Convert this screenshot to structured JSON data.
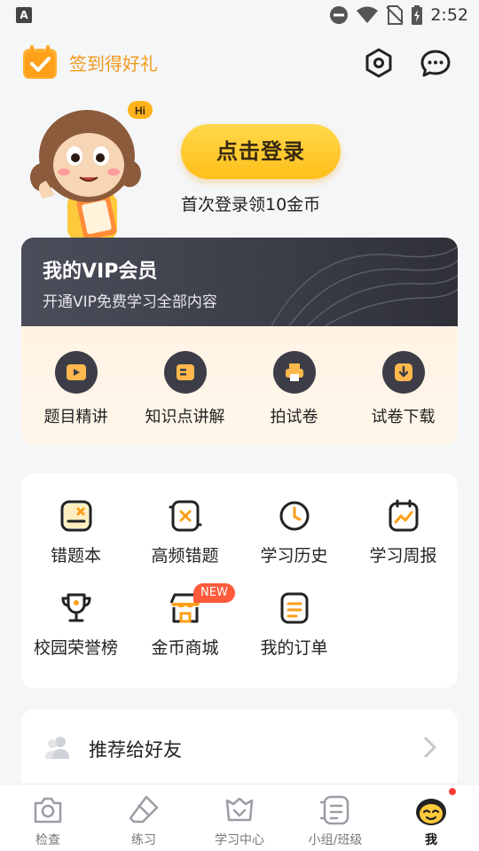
{
  "status_bar": {
    "time": "2:52",
    "notification_letter": "A"
  },
  "header": {
    "checkin_label": "签到得好礼"
  },
  "profile": {
    "mascot_bubble": "Hi",
    "login_button": "点击登录",
    "login_hint": "首次登录领10金币"
  },
  "vip": {
    "title": "我的VIP会员",
    "subtitle": "开通VIP免费学习全部内容",
    "items": [
      {
        "label": "题目精讲",
        "icon": "play-icon"
      },
      {
        "label": "知识点讲解",
        "icon": "book-icon"
      },
      {
        "label": "拍试卷",
        "icon": "printer-icon"
      },
      {
        "label": "试卷下载",
        "icon": "download-icon"
      }
    ]
  },
  "tools": {
    "items": [
      {
        "label": "错题本",
        "icon": "wrong-notebook-icon"
      },
      {
        "label": "高频错题",
        "icon": "frequent-error-icon"
      },
      {
        "label": "学习历史",
        "icon": "clock-icon"
      },
      {
        "label": "学习周报",
        "icon": "weekly-report-icon"
      },
      {
        "label": "校园荣誉榜",
        "icon": "trophy-icon"
      },
      {
        "label": "金币商城",
        "icon": "shop-icon",
        "badge": "NEW"
      },
      {
        "label": "我的订单",
        "icon": "order-icon"
      }
    ]
  },
  "recommend": {
    "label": "推荐给好友"
  },
  "bottom_nav": {
    "items": [
      {
        "label": "检查",
        "icon": "camera-icon"
      },
      {
        "label": "练习",
        "icon": "eraser-icon"
      },
      {
        "label": "学习中心",
        "icon": "study-center-icon"
      },
      {
        "label": "小组/班级",
        "icon": "group-icon"
      },
      {
        "label": "我",
        "icon": "me-avatar-icon",
        "active": true
      }
    ]
  },
  "colors": {
    "accent_orange": "#f19a1e",
    "login_yellow": "#ffc928",
    "vip_dark": "#3c3d47",
    "badge_red": "#ff5a3c"
  }
}
